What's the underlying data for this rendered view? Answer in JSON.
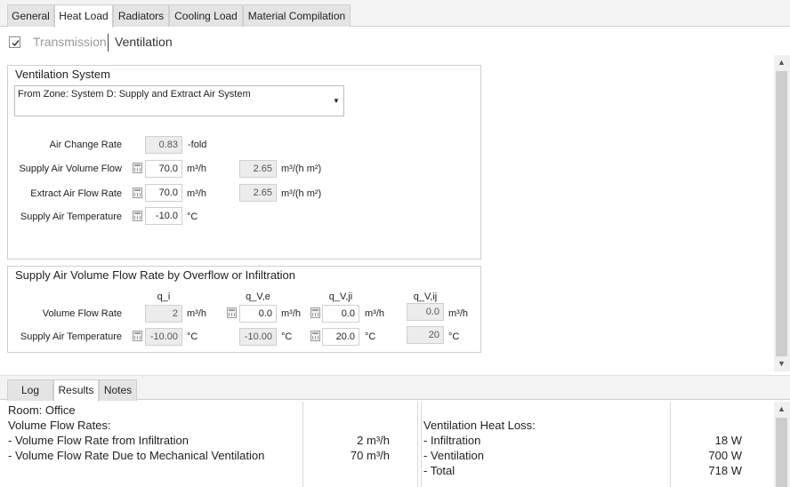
{
  "tabs": [
    "General",
    "Heat Load",
    "Radiators",
    "Cooling Load",
    "Material Compilation"
  ],
  "subtabs": {
    "transmission": "Transmission",
    "ventilation": "Ventilation"
  },
  "ventilation_system": {
    "title": "Ventilation System",
    "selected": "From Zone: System D: Supply and Extract Air System",
    "air_change_rate": {
      "label": "Air Change Rate",
      "value": "0.83",
      "unit": "-fold"
    },
    "supply_air_volume_flow": {
      "label": "Supply Air Volume Flow",
      "value": "70.0",
      "unit": "m³/h",
      "specific": "2.65",
      "specific_unit": "m³/(h m²)"
    },
    "extract_air_flow_rate": {
      "label": "Extract Air Flow Rate",
      "value": "70.0",
      "unit": "m³/h",
      "specific": "2.65",
      "specific_unit": "m³/(h m²)"
    },
    "supply_air_temperature": {
      "label": "Supply Air Temperature",
      "value": "-10.0",
      "unit": "°C"
    }
  },
  "overflow": {
    "title": "Supply Air Volume Flow Rate by Overflow or Infiltration",
    "columns": [
      "q_i",
      "q_V,e",
      "q_V,ji",
      "q_V,ij"
    ],
    "volume_flow_rate": {
      "label": "Volume Flow Rate",
      "values": [
        "2",
        "0.0",
        "0.0",
        "0.0"
      ],
      "unit": "m³/h"
    },
    "supply_air_temperature": {
      "label": "Supply Air Temperature",
      "values": [
        "-10.00",
        "-10.00",
        "20.0",
        "20"
      ],
      "unit": "°C"
    }
  },
  "bottom_tabs": [
    "Log",
    "Results",
    "Notes"
  ],
  "results": {
    "room": "Room: Office",
    "volume_flow_rates": "Volume Flow Rates:",
    "infiltration_label": "- Volume Flow Rate from Infiltration",
    "infiltration_value": "2 m³/h",
    "mechanical_label": "- Volume Flow Rate Due to Mechanical Ventilation",
    "mechanical_value": "70 m³/h",
    "heat_loss_title": "Ventilation Heat Loss:",
    "hl_infiltration_label": "- Infiltration",
    "hl_infiltration_value": "18 W",
    "hl_ventilation_label": "- Ventilation",
    "hl_ventilation_value": "700 W",
    "hl_total_label": "- Total",
    "hl_total_value": "718 W"
  }
}
